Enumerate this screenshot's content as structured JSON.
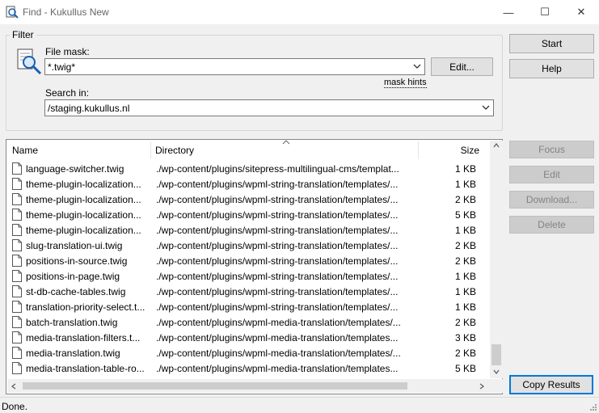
{
  "window": {
    "title": "Find - Kukullus New",
    "minimize_glyph": "—",
    "maximize_glyph": "☐",
    "close_glyph": "✕"
  },
  "filter": {
    "group_label": "Filter",
    "file_mask_label": "File mask:",
    "file_mask_value": "*.twig*",
    "edit_button": "Edit...",
    "mask_hints_link": "mask hints",
    "search_in_label": "Search in:",
    "search_in_value": "/staging.kukullus.nl"
  },
  "side_buttons": {
    "start": "Start",
    "help": "Help",
    "focus": "Focus",
    "edit": "Edit",
    "download": "Download...",
    "delete": "Delete",
    "copy_results": "Copy Results"
  },
  "results": {
    "columns": [
      "Name",
      "Directory",
      "Size"
    ],
    "rows": [
      {
        "name": "language-switcher.twig",
        "dir": "./wp-content/plugins/sitepress-multilingual-cms/templat...",
        "size": "1 KB"
      },
      {
        "name": "theme-plugin-localization...",
        "dir": "./wp-content/plugins/wpml-string-translation/templates/...",
        "size": "1 KB"
      },
      {
        "name": "theme-plugin-localization...",
        "dir": "./wp-content/plugins/wpml-string-translation/templates/...",
        "size": "2 KB"
      },
      {
        "name": "theme-plugin-localization...",
        "dir": "./wp-content/plugins/wpml-string-translation/templates/...",
        "size": "5 KB"
      },
      {
        "name": "theme-plugin-localization...",
        "dir": "./wp-content/plugins/wpml-string-translation/templates/...",
        "size": "1 KB"
      },
      {
        "name": "slug-translation-ui.twig",
        "dir": "./wp-content/plugins/wpml-string-translation/templates/...",
        "size": "2 KB"
      },
      {
        "name": "positions-in-source.twig",
        "dir": "./wp-content/plugins/wpml-string-translation/templates/...",
        "size": "2 KB"
      },
      {
        "name": "positions-in-page.twig",
        "dir": "./wp-content/plugins/wpml-string-translation/templates/...",
        "size": "1 KB"
      },
      {
        "name": "st-db-cache-tables.twig",
        "dir": "./wp-content/plugins/wpml-string-translation/templates/...",
        "size": "1 KB"
      },
      {
        "name": "translation-priority-select.t...",
        "dir": "./wp-content/plugins/wpml-string-translation/templates/...",
        "size": "1 KB"
      },
      {
        "name": "batch-translation.twig",
        "dir": "./wp-content/plugins/wpml-media-translation/templates/...",
        "size": "2 KB"
      },
      {
        "name": "media-translation-filters.t...",
        "dir": "./wp-content/plugins/wpml-media-translation/templates...",
        "size": "3 KB"
      },
      {
        "name": "media-translation.twig",
        "dir": "./wp-content/plugins/wpml-media-translation/templates/...",
        "size": "2 KB"
      },
      {
        "name": "media-translation-table-ro...",
        "dir": "./wp-content/plugins/wpml-media-translation/templates...",
        "size": "5 KB"
      }
    ]
  },
  "status": "Done.",
  "icons": {
    "app": "find-icon",
    "filter": "magnifier-document-icon",
    "file": "file-icon"
  },
  "colors": {
    "accent": "#0078d7",
    "background": "#f0f0f0",
    "disabled_text": "#838383"
  }
}
